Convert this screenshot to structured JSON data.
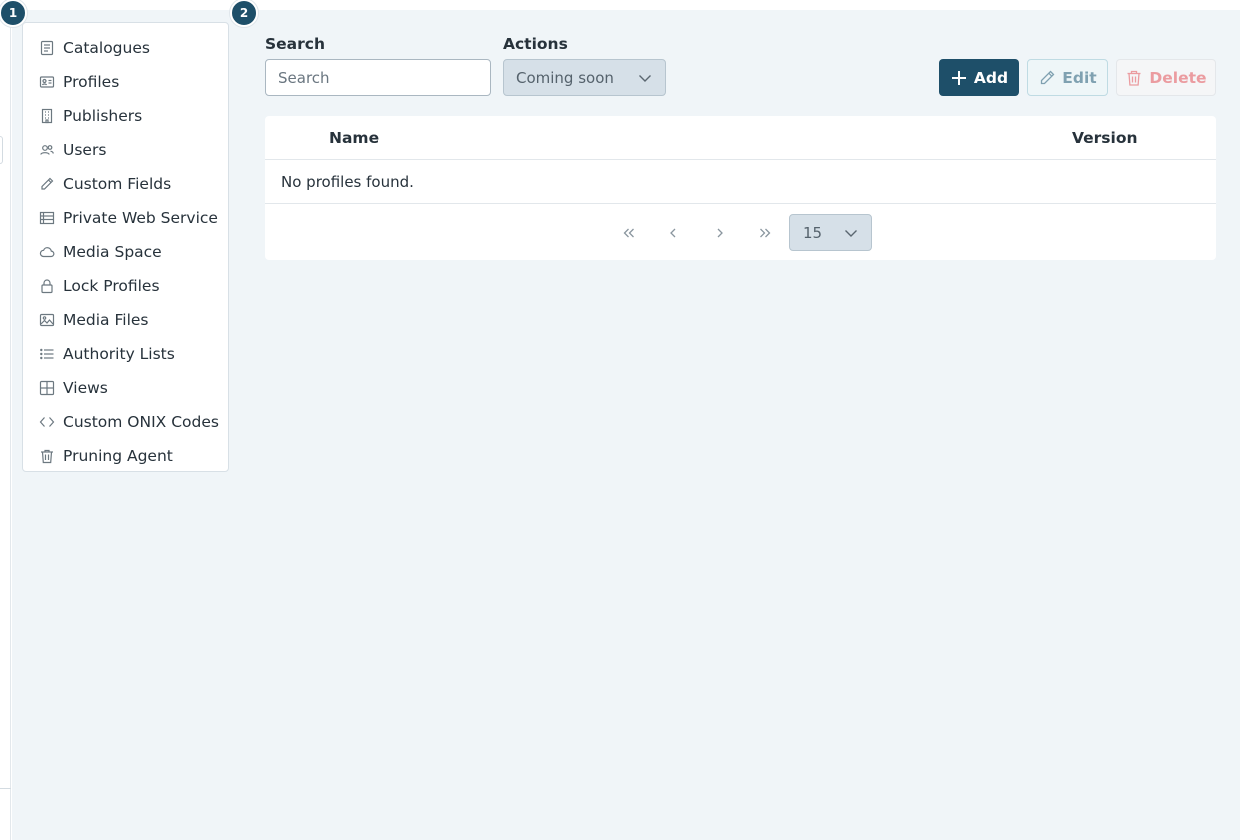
{
  "badges": {
    "first": "1",
    "second": "2"
  },
  "menu": {
    "items": [
      {
        "label": "Catalogues",
        "icon": "document-icon"
      },
      {
        "label": "Profiles",
        "icon": "id-card-icon"
      },
      {
        "label": "Publishers",
        "icon": "building-icon"
      },
      {
        "label": "Users",
        "icon": "users-icon"
      },
      {
        "label": "Custom Fields",
        "icon": "pencil-icon"
      },
      {
        "label": "Private Web Service",
        "icon": "server-list-icon"
      },
      {
        "label": "Media Space",
        "icon": "cloud-icon"
      },
      {
        "label": "Lock Profiles",
        "icon": "lock-icon"
      },
      {
        "label": "Media Files",
        "icon": "image-icon"
      },
      {
        "label": "Authority Lists",
        "icon": "list-icon"
      },
      {
        "label": "Views",
        "icon": "grid-icon"
      },
      {
        "label": "Custom ONIX Codes",
        "icon": "code-icon"
      },
      {
        "label": "Pruning Agent",
        "icon": "trash-icon"
      }
    ]
  },
  "toolbar": {
    "search_label": "Search",
    "search_placeholder": "Search",
    "search_value": "",
    "actions_label": "Actions",
    "actions_value": "Coming soon",
    "add_label": "Add",
    "edit_label": "Edit",
    "delete_label": "Delete"
  },
  "table": {
    "columns": [
      "Name",
      "Version"
    ],
    "empty_message": "No profiles found."
  },
  "pagination": {
    "page_size": "15"
  },
  "colors": {
    "primary": "#1e4f69",
    "background": "#f0f5f8",
    "delete_text": "#eb9ca0"
  }
}
